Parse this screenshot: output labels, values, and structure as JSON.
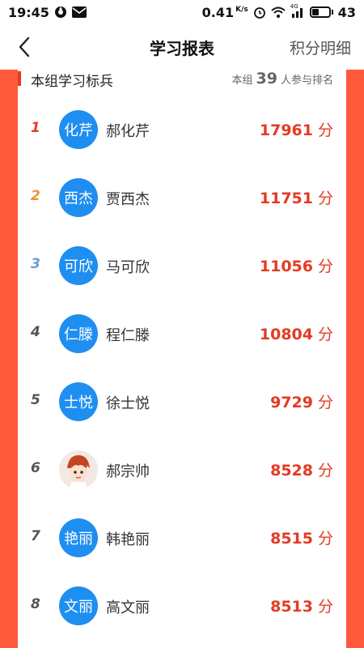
{
  "status_bar": {
    "time": "19:45",
    "net_speed": "0.41",
    "net_unit": "K/s",
    "net_type": "4G",
    "battery": "43",
    "battery_level": 0.43,
    "icons": [
      "assistant-icon",
      "mail-icon",
      "alarm-icon",
      "wifi-icon",
      "signal-icon",
      "battery-icon"
    ]
  },
  "header": {
    "back_icon": "back-chevron-icon",
    "title": "学习报表",
    "right_action": "积分明细"
  },
  "section": {
    "title": "本组学习标兵",
    "participants_prefix": "本组",
    "participants_count": "39",
    "participants_suffix": "人参与排名"
  },
  "colors": {
    "accent": "#e53a23",
    "side_strip": "#ff5a3c",
    "avatar_blue": "#1f8ef1",
    "rank1": "#e53a23",
    "rank2": "#f0913a",
    "rank3": "#6b9bd1",
    "rank_other": "#555555"
  },
  "rankings": [
    {
      "rank": "1",
      "avatar_text": "化芹",
      "name": "郝化芹",
      "score": "17961",
      "unit": "分"
    },
    {
      "rank": "2",
      "avatar_text": "西杰",
      "name": "贾西杰",
      "score": "11751",
      "unit": "分"
    },
    {
      "rank": "3",
      "avatar_text": "可欣",
      "name": "马可欣",
      "score": "11056",
      "unit": "分"
    },
    {
      "rank": "4",
      "avatar_text": "仁滕",
      "name": "程仁滕",
      "score": "10804",
      "unit": "分"
    },
    {
      "rank": "5",
      "avatar_text": "士悦",
      "name": "徐士悦",
      "score": "9729",
      "unit": "分"
    },
    {
      "rank": "6",
      "avatar_text": "",
      "avatar_image": "cartoon-avatar",
      "name": "郝宗帅",
      "score": "8528",
      "unit": "分"
    },
    {
      "rank": "7",
      "avatar_text": "艳丽",
      "name": "韩艳丽",
      "score": "8515",
      "unit": "分"
    },
    {
      "rank": "8",
      "avatar_text": "文丽",
      "name": "高文丽",
      "score": "8513",
      "unit": "分"
    }
  ]
}
